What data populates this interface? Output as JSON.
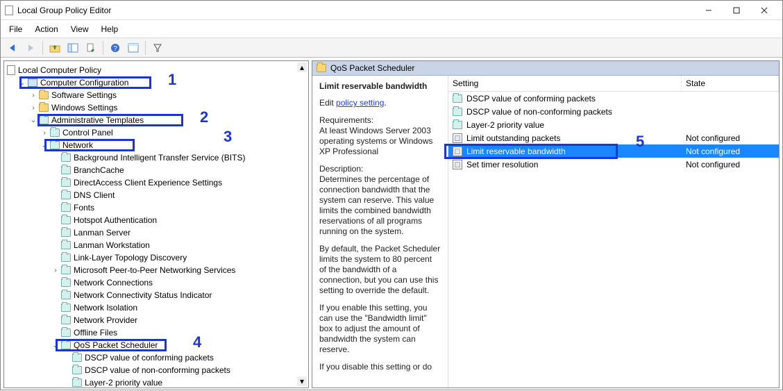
{
  "window": {
    "title": "Local Group Policy Editor"
  },
  "menus": {
    "file": "File",
    "action": "Action",
    "view": "View",
    "help": "Help"
  },
  "toolbar_icons": [
    "back",
    "forward",
    "up",
    "toggle-tree",
    "export",
    "help",
    "properties",
    "filter"
  ],
  "tree": {
    "root": "Local Computer Policy",
    "cc": "Computer Configuration",
    "ss": "Software Settings",
    "ws": "Windows Settings",
    "at": "Administrative Templates",
    "cp": "Control Panel",
    "net": "Network",
    "net_children": [
      "Background Intelligent Transfer Service (BITS)",
      "BranchCache",
      "DirectAccess Client Experience Settings",
      "DNS Client",
      "Fonts",
      "Hotspot Authentication",
      "Lanman Server",
      "Lanman Workstation",
      "Link-Layer Topology Discovery",
      "Microsoft Peer-to-Peer Networking Services",
      "Network Connections",
      "Network Connectivity Status Indicator",
      "Network Isolation",
      "Network Provider",
      "Offline Files",
      "QoS Packet Scheduler"
    ],
    "qos_children": [
      "DSCP value of conforming packets",
      "DSCP value of non-conforming packets",
      "Layer-2 priority value"
    ]
  },
  "right": {
    "header": "QoS Packet Scheduler",
    "detail_title": "Limit reservable bandwidth",
    "edit_label": "Edit",
    "edit_link": "policy setting",
    "req_label": "Requirements:",
    "req_text": "At least Windows Server 2003 operating systems or Windows XP Professional",
    "desc_label": "Description:",
    "desc1": "Determines the percentage of connection bandwidth that the system can reserve. This value limits the combined bandwidth reservations of all programs running on the system.",
    "desc2": "By default, the Packet Scheduler limits the system to 80 percent of the bandwidth of a connection, but you can use this setting to override the default.",
    "desc3": "If you enable this setting, you can use the \"Bandwidth limit\" box to adjust the amount of bandwidth the system can reserve.",
    "desc4": "If you disable this setting or do"
  },
  "columns": {
    "setting": "Setting",
    "state": "State"
  },
  "settings": [
    {
      "name": "DSCP value of conforming packets",
      "state": "",
      "folder": true
    },
    {
      "name": "DSCP value of non-conforming packets",
      "state": "",
      "folder": true
    },
    {
      "name": "Layer-2 priority value",
      "state": "",
      "folder": true
    },
    {
      "name": "Limit outstanding packets",
      "state": "Not configured",
      "folder": false
    },
    {
      "name": "Limit reservable bandwidth",
      "state": "Not configured",
      "folder": false,
      "selected": true
    },
    {
      "name": "Set timer resolution",
      "state": "Not configured",
      "folder": false
    }
  ],
  "annotations": {
    "n1": "1",
    "n2": "2",
    "n3": "3",
    "n4": "4",
    "n5": "5"
  }
}
